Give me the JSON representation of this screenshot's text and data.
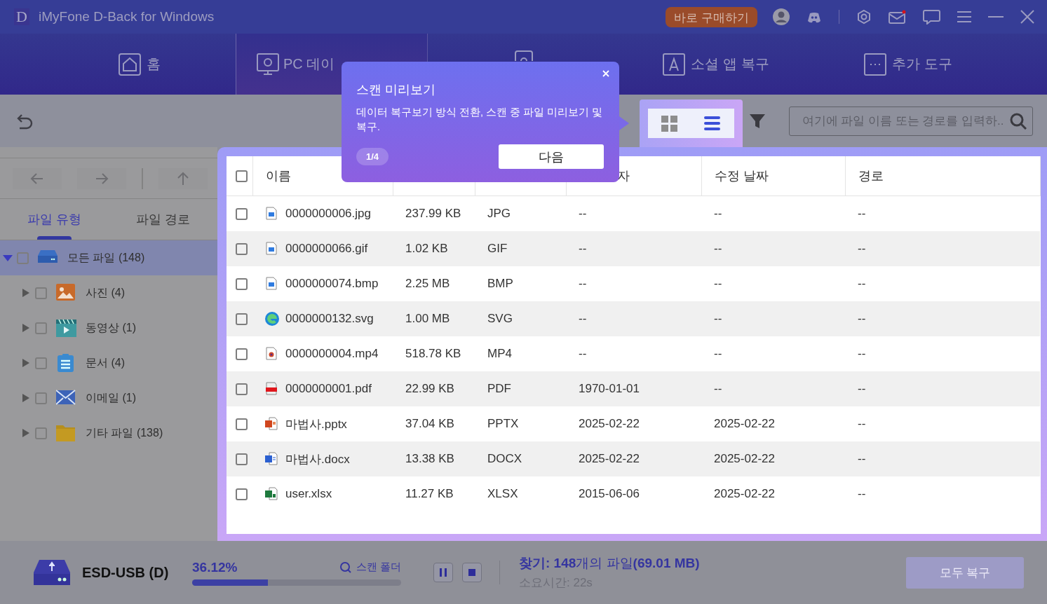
{
  "window": {
    "logo": "D",
    "title": "iMyFone D-Back for Windows",
    "buy_button": "바로 구매하기",
    "mail_unread": true
  },
  "nav_tabs": [
    {
      "label": "홈",
      "selected": false
    },
    {
      "label": "PC 데이",
      "selected": true
    },
    {
      "selected": false
    },
    {
      "label": "소셜 앱 복구",
      "selected": false
    },
    {
      "label": "추가 도구",
      "selected": false
    }
  ],
  "sidebar": {
    "tabs": [
      {
        "label": "파일 유형",
        "selected": true
      },
      {
        "label": "파일 경로",
        "selected": false
      }
    ],
    "tree": [
      {
        "label": "모든 파일 (148)",
        "kind": "drive",
        "expanded": true,
        "checked": false,
        "selected": true,
        "children": [
          {
            "label": "사진 (4)",
            "kind": "photo",
            "expanded": false,
            "checked": false,
            "selected": false
          },
          {
            "label": "동영상 (1)",
            "kind": "video",
            "expanded": false,
            "checked": false,
            "selected": false
          },
          {
            "label": "문서 (4)",
            "kind": "document",
            "expanded": false,
            "checked": false,
            "selected": false
          },
          {
            "label": "이메일 (1)",
            "kind": "email",
            "expanded": false,
            "checked": false,
            "selected": false
          },
          {
            "label": "기타  파일 (138)",
            "kind": "folder",
            "expanded": false,
            "checked": false,
            "selected": false
          }
        ]
      }
    ]
  },
  "view_toggle": [
    {
      "kind": "grid",
      "selected": false
    },
    {
      "kind": "list",
      "selected": true
    }
  ],
  "search": {
    "placeholder": "여기에 파일 이름 또는 경로를 입력하.."
  },
  "table": {
    "all_checked": false,
    "columns": [
      {
        "label": "이름"
      },
      {},
      {},
      {
        "label": "자"
      },
      {
        "label": "수정 날짜"
      },
      {
        "label": "경로"
      }
    ],
    "rows": [
      {
        "name": "0000000006.jpg",
        "kind": "image",
        "size": "237.99 KB",
        "type": "JPG",
        "created": "--",
        "modified": "--",
        "path": "--",
        "checked": false
      },
      {
        "name": "0000000066.gif",
        "kind": "image",
        "size": "1.02 KB",
        "type": "GIF",
        "created": "--",
        "modified": "--",
        "path": "--",
        "checked": false
      },
      {
        "name": "0000000074.bmp",
        "kind": "image",
        "size": "2.25 MB",
        "type": "BMP",
        "created": "--",
        "modified": "--",
        "path": "--",
        "checked": false
      },
      {
        "name": "0000000132.svg",
        "kind": "browser",
        "size": "1.00 MB",
        "type": "SVG",
        "created": "--",
        "modified": "--",
        "path": "--",
        "checked": false
      },
      {
        "name": "0000000004.mp4",
        "kind": "video",
        "size": "518.78 KB",
        "type": "MP4",
        "created": "--",
        "modified": "--",
        "path": "--",
        "checked": false
      },
      {
        "name": "0000000001.pdf",
        "kind": "pdf",
        "size": "22.99 KB",
        "type": "PDF",
        "created": "1970-01-01",
        "modified": "--",
        "path": "--",
        "checked": false
      },
      {
        "name": "마법사.pptx",
        "kind": "pptx",
        "size": "37.04 KB",
        "type": "PPTX",
        "created": "2025-02-22",
        "modified": "2025-02-22",
        "path": "--",
        "checked": false
      },
      {
        "name": "마법사.docx",
        "kind": "docx",
        "size": "13.38 KB",
        "type": "DOCX",
        "created": "2025-02-22",
        "modified": "2025-02-22",
        "path": "--",
        "checked": false
      },
      {
        "name": "user.xlsx",
        "kind": "xlsx",
        "size": "11.27 KB",
        "type": "XLSX",
        "created": "2015-06-06",
        "modified": "2025-02-22",
        "path": "--",
        "checked": false
      }
    ]
  },
  "tooltip": {
    "title": "스캔 미리보기",
    "text": "데이터 복구보기 방식 전환, 스캔 중 파일 미리보기 및 복구.",
    "step": "1/4",
    "next_button": "다음"
  },
  "status": {
    "drive": "ESD-USB (D)",
    "percent": "36.12%",
    "level": 0.3612,
    "scan_folder": "스캔 폴더",
    "found": "**찾기: 148**개의 파일**(69.01 MB)**",
    "elapsed": "소요시간: 22s",
    "recover_button": {
      "label": "모두 복구",
      "disabled": true
    }
  }
}
